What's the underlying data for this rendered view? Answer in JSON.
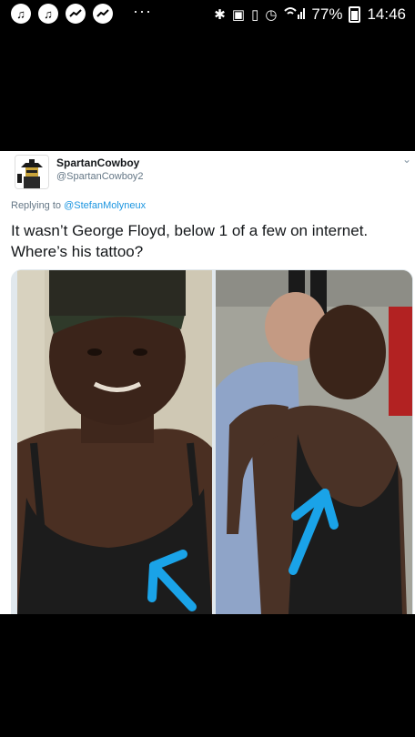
{
  "status_bar": {
    "battery_percent": "77%",
    "time": "14:46",
    "overflow": "···"
  },
  "tweet": {
    "display_name": "SpartanCowboy",
    "handle": "@SpartanCowboy2",
    "replying_prefix": "Replying to ",
    "replying_to": "@StefanMolyneux",
    "text_line1": "It wasn’t George Floyd, below 1 of a few on internet.",
    "text_line2": "Where’s his tattoo?"
  },
  "colors": {
    "link": "#1b95e0",
    "arrow": "#1aa3e8",
    "background": "#000000"
  }
}
